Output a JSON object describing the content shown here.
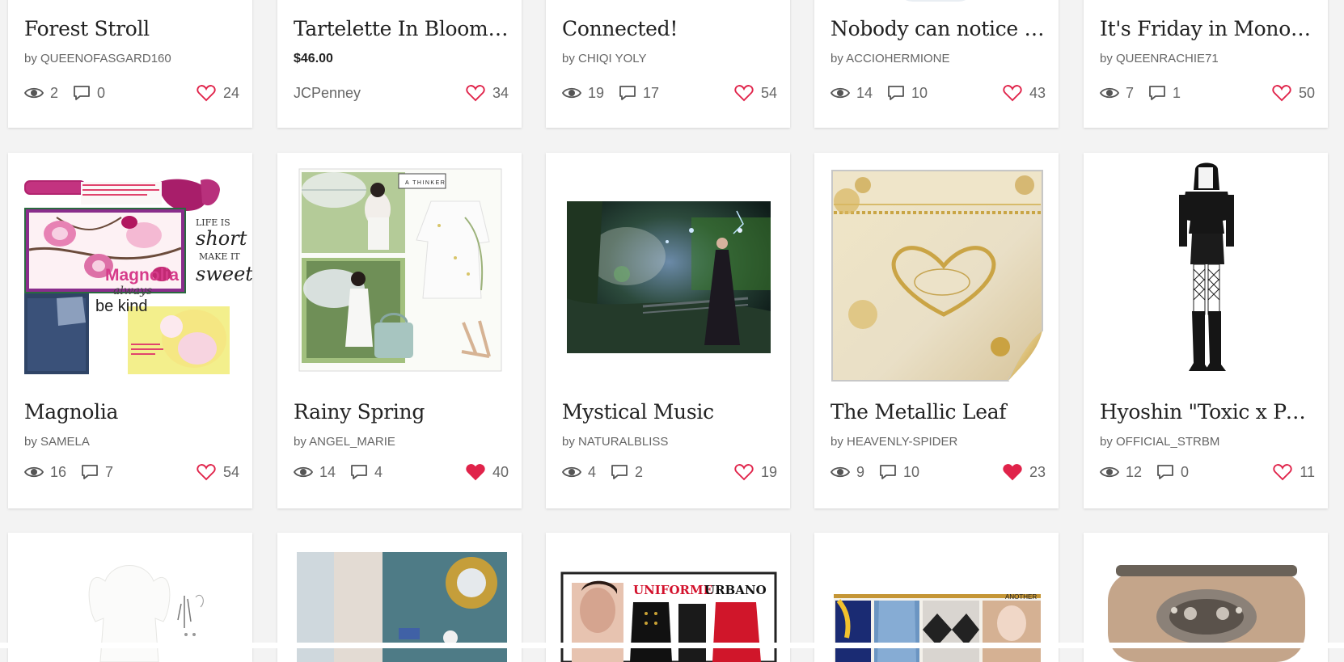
{
  "cards": [
    {
      "title": "Forest Stroll",
      "by": "by QUEENOFASGARD160",
      "views": "2",
      "comments": "0",
      "likes": "24",
      "liked": false
    },
    {
      "title": "Tartelette In Bloom C...",
      "price": "$46.00",
      "shop": "JCPenney",
      "likes": "34",
      "liked": false
    },
    {
      "title": "Connected!",
      "by": "by CHIQI YOLY",
      "views": "19",
      "comments": "17",
      "likes": "54",
      "liked": false
    },
    {
      "title": "Nobody can notice yo...",
      "by": "by ACCIOHERMIONE",
      "views": "14",
      "comments": "10",
      "likes": "43",
      "liked": false
    },
    {
      "title": "It's Friday in Monoch...",
      "by": "by QUEENRACHIE71",
      "views": "7",
      "comments": "1",
      "likes": "50",
      "liked": false
    },
    {
      "title": "Magnolia",
      "by": "by SAMELA",
      "views": "16",
      "comments": "7",
      "likes": "54",
      "liked": false,
      "collage": {
        "word1": "Magnolia",
        "word2": "always",
        "word3": "be kind",
        "script1": "LIFE IS",
        "script2": "short",
        "script3": "MAKE IT",
        "script4": "sweet"
      }
    },
    {
      "title": "Rainy Spring",
      "by": "by ANGEL_MARIE",
      "views": "14",
      "comments": "4",
      "likes": "40",
      "liked": true,
      "collage": {
        "tag": "A THINKER"
      }
    },
    {
      "title": "Mystical Music",
      "by": "by NATURALBLISS",
      "views": "4",
      "comments": "2",
      "likes": "19",
      "liked": false
    },
    {
      "title": "The Metallic Leaf",
      "by": "by HEAVENLY-SPIDER",
      "views": "9",
      "comments": "10",
      "likes": "23",
      "liked": true
    },
    {
      "title": "Hyoshin \"Toxic x Pon...",
      "by": "by OFFICIAL_STRBM",
      "views": "12",
      "comments": "0",
      "likes": "11",
      "liked": false
    },
    {
      "thumb": "white-dress"
    },
    {
      "thumb": "interior"
    },
    {
      "thumb": "uniforme",
      "collage": {
        "word1": "UNIFORME",
        "word2": "URBANO"
      }
    },
    {
      "thumb": "fashion-collage",
      "collage": {
        "word1": "ANOTHER"
      }
    },
    {
      "thumb": "handbag"
    }
  ],
  "colors": {
    "heart": "#e0234a",
    "text": "#222222",
    "muted": "#666666"
  }
}
